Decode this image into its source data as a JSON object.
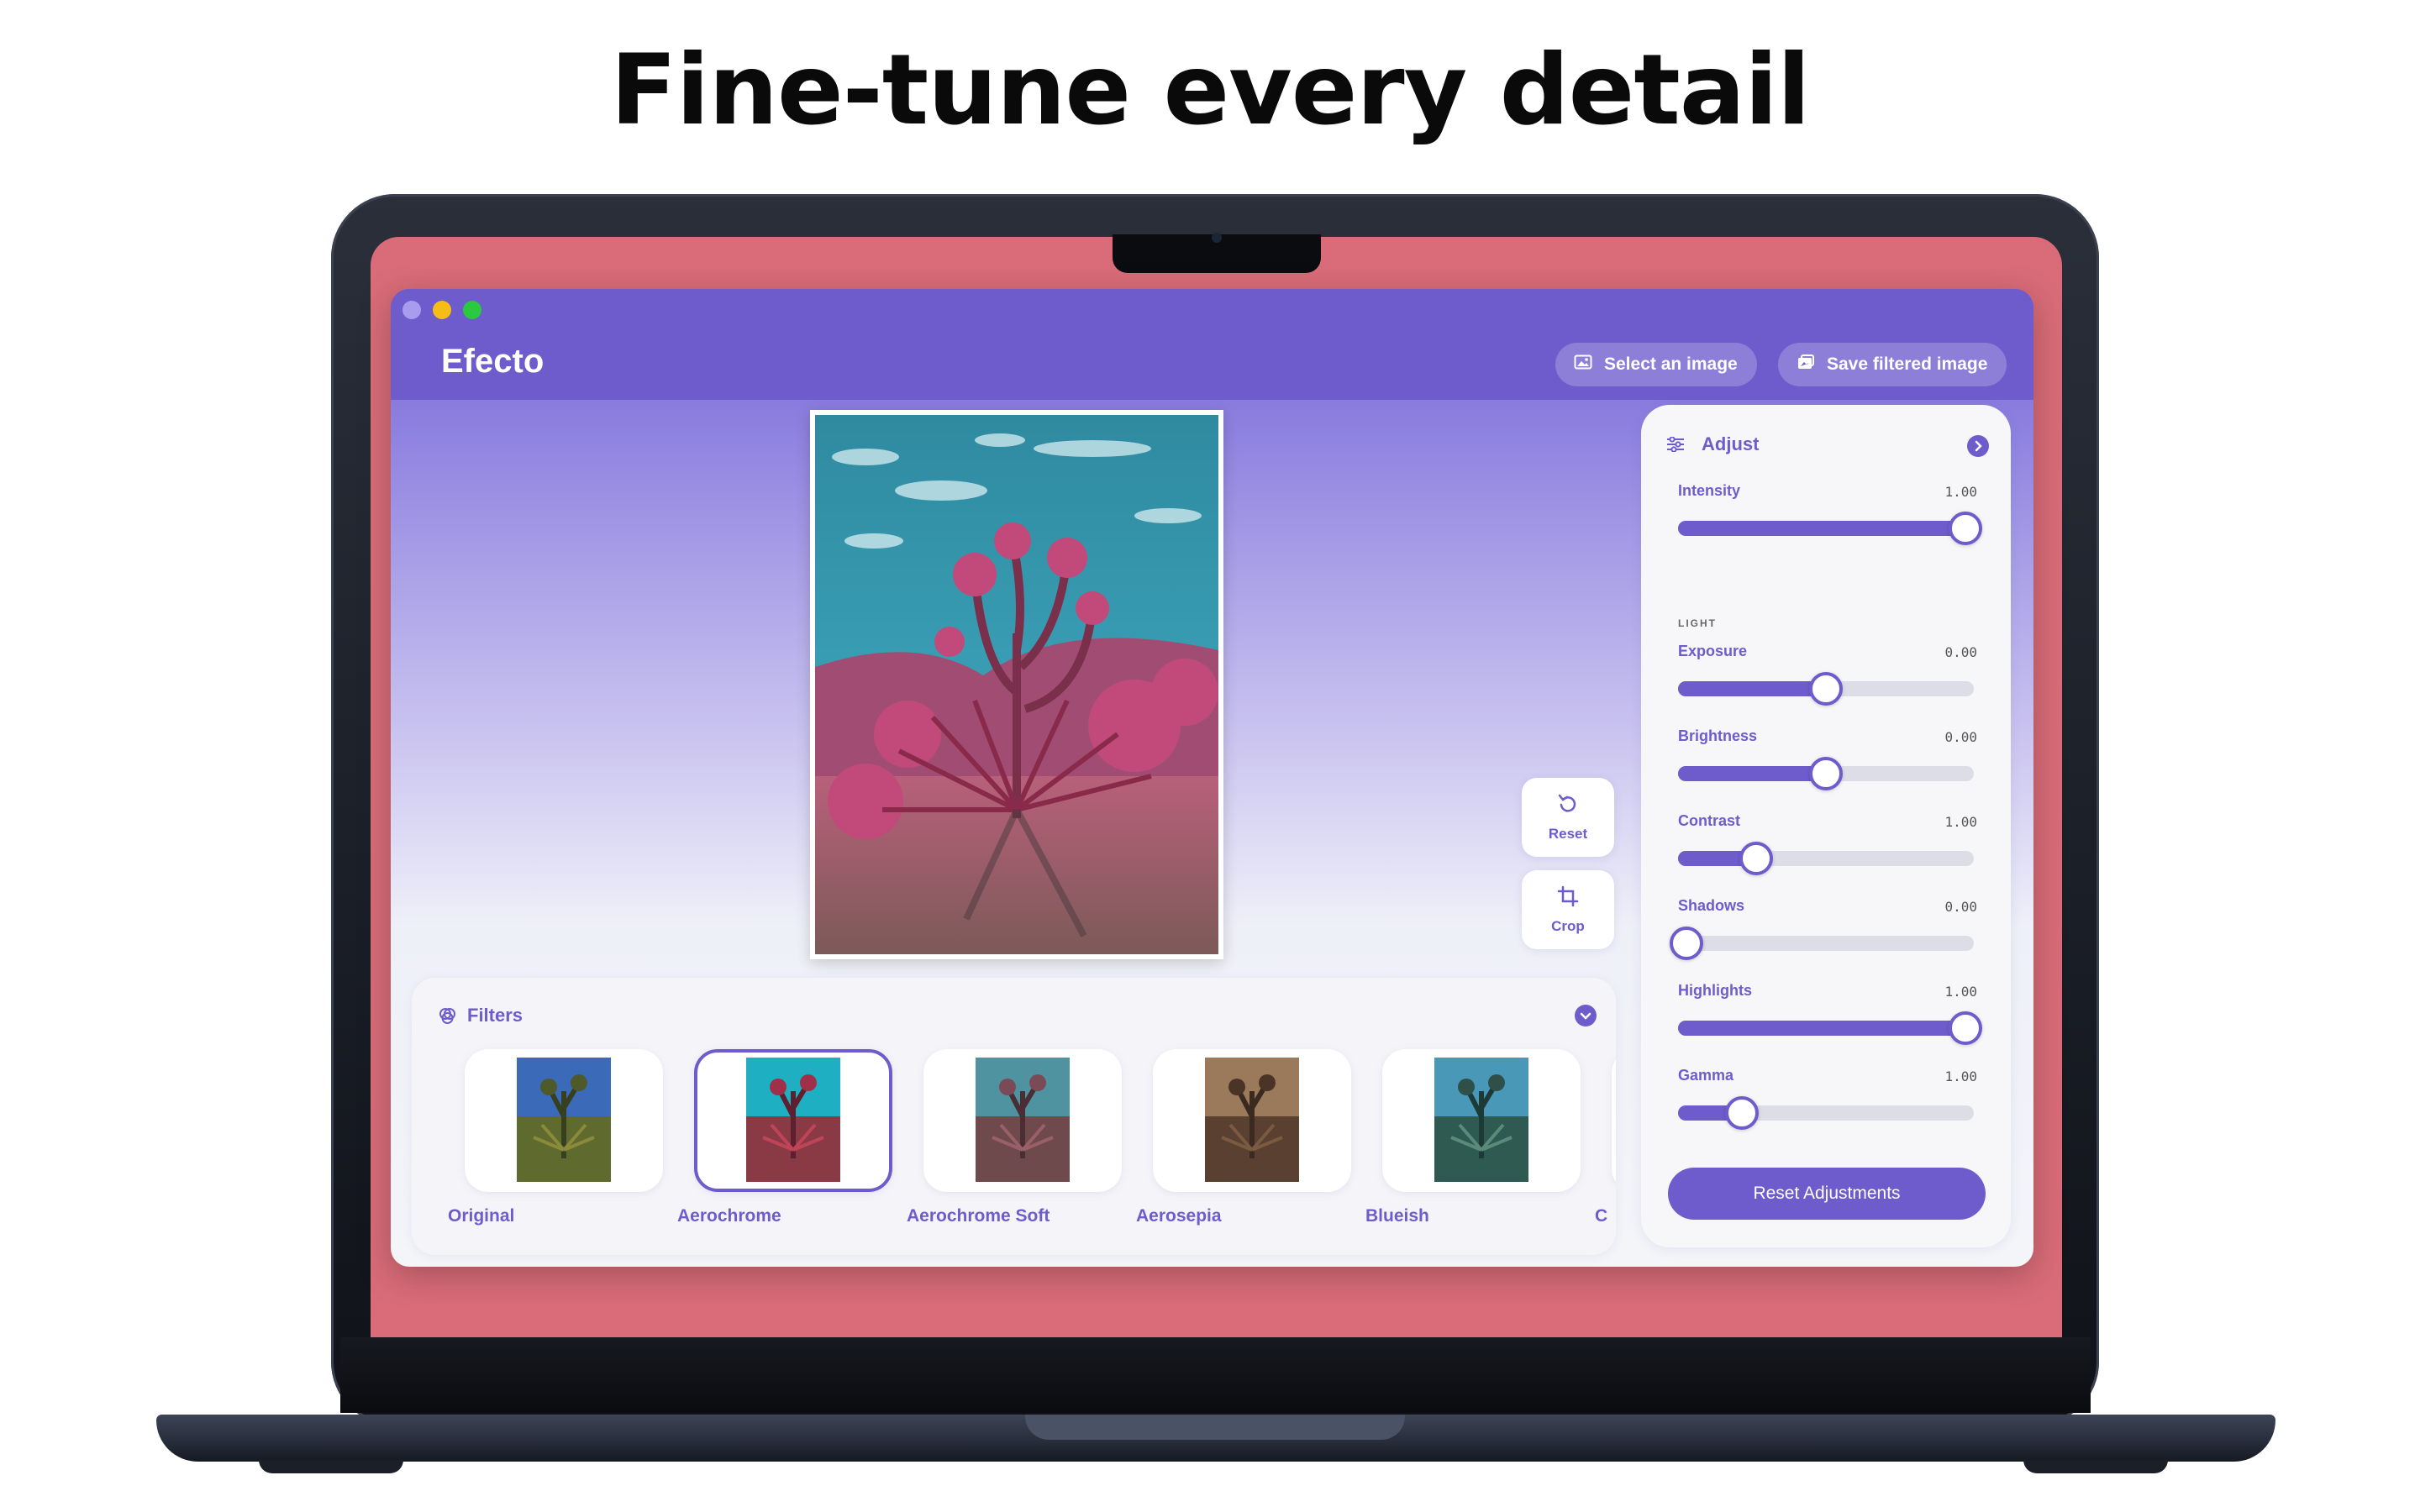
{
  "headline": "Fine-tune every detail",
  "app": {
    "title": "Efecto"
  },
  "toolbar": {
    "select_image_label": "Select an image",
    "save_image_label": "Save filtered image"
  },
  "tools": {
    "reset_label": "Reset",
    "crop_label": "Crop"
  },
  "filters": {
    "title": "Filters",
    "items": [
      {
        "label": "Original",
        "selected": false
      },
      {
        "label": "Aerochrome",
        "selected": true
      },
      {
        "label": "Aerochrome Soft",
        "selected": false
      },
      {
        "label": "Aerosepia",
        "selected": false
      },
      {
        "label": "Blueish",
        "selected": false
      },
      {
        "label": "C",
        "selected": false
      }
    ]
  },
  "adjust": {
    "title": "Adjust",
    "intensity": {
      "label": "Intensity",
      "value": "1.00",
      "level": 1.0
    },
    "light_section": "LIGHT",
    "sliders": [
      {
        "label": "Exposure",
        "value": "0.00",
        "level": 0.5
      },
      {
        "label": "Brightness",
        "value": "0.00",
        "level": 0.5
      },
      {
        "label": "Contrast",
        "value": "1.00",
        "level": 0.25
      },
      {
        "label": "Shadows",
        "value": "0.00",
        "level": 0.0
      },
      {
        "label": "Highlights",
        "value": "1.00",
        "level": 1.0
      },
      {
        "label": "Gamma",
        "value": "1.00",
        "level": 0.2
      }
    ],
    "reset_label": "Reset Adjustments"
  },
  "colors": {
    "accent": "#6e5ccc",
    "screen": "#d96c78"
  }
}
